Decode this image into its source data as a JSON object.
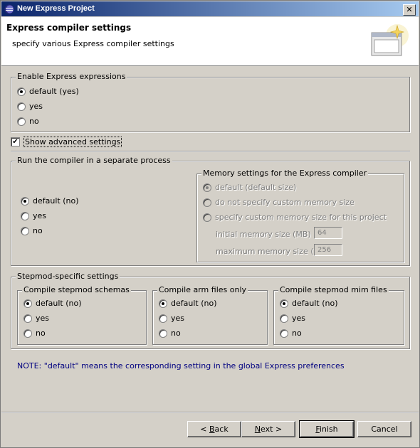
{
  "window": {
    "title": "New Express Project"
  },
  "header": {
    "title": "Express compiler settings",
    "subtitle": "specify various Express compiler settings"
  },
  "enable_expressions": {
    "legend": "Enable Express expressions",
    "options": [
      "default (yes)",
      "yes",
      "no"
    ],
    "selected": "default (yes)"
  },
  "advanced": {
    "label": "Show advanced settings",
    "checked": true
  },
  "separate_process": {
    "legend": "Run the compiler in a separate process",
    "options": [
      "default (no)",
      "yes",
      "no"
    ],
    "selected": "default (no)"
  },
  "memory": {
    "legend": "Memory settings for the Express compiler",
    "options": [
      "default (default size)",
      "do not specify custom memory size",
      "specify custom memory size for this project"
    ],
    "selected": "default (default size)",
    "initial_label": "initial memory size (MB)",
    "initial_value": "64",
    "max_label": "maximum memory size (MB)",
    "max_value": "256"
  },
  "stepmod": {
    "legend": "Stepmod-specific settings",
    "schemas": {
      "legend": "Compile stepmod schemas",
      "options": [
        "default (no)",
        "yes",
        "no"
      ]
    },
    "arm": {
      "legend": "Compile arm files only",
      "options": [
        "default (no)",
        "yes",
        "no"
      ]
    },
    "mim": {
      "legend": "Compile stepmod mim files",
      "options": [
        "default (no)",
        "yes",
        "no"
      ]
    }
  },
  "note": "NOTE: \"default\" means the corresponding setting in the global Express preferences",
  "buttons": {
    "back_prefix": "< ",
    "back_mnemonic": "B",
    "back_rest": "ack",
    "next_mnemonic": "N",
    "next_rest": "ext >",
    "finish_mnemonic": "F",
    "finish_rest": "inish",
    "cancel": "Cancel"
  }
}
